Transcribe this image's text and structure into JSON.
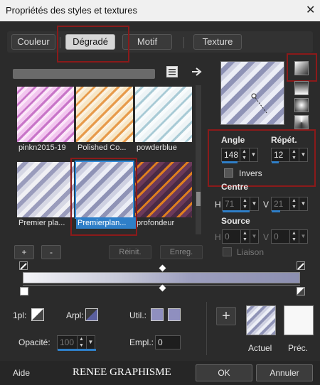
{
  "window": {
    "title": "Propriétés des styles et textures",
    "close_glyph": "✕"
  },
  "tabs": [
    {
      "label": "Couleur"
    },
    {
      "label": "Dégradé"
    },
    {
      "label": "Motif"
    },
    {
      "label": "Texture"
    }
  ],
  "swatches": [
    {
      "label": "pinkn2015-19",
      "colors": [
        "#f2c6ef",
        "#c874c8"
      ]
    },
    {
      "label": "Polished Co...",
      "colors": [
        "#f6e6c6",
        "#e79a4a"
      ]
    },
    {
      "label": "powderblue",
      "colors": [
        "#eef4f6",
        "#a9cbd6"
      ]
    },
    {
      "label": "Premier pla...",
      "colors": [
        "#f0f0f4",
        "#9a9cbc"
      ]
    },
    {
      "label": "Premierplan...",
      "colors": [
        "#eceef6",
        "#8f93b6"
      ]
    },
    {
      "label": "profondeur",
      "colors": [
        "#4a2a44",
        "#e0801e"
      ]
    }
  ],
  "list_buttons": {
    "add": "+",
    "remove": "-",
    "reset": "Réinit.",
    "save": "Enreg."
  },
  "gradient": {
    "angle_label": "Angle",
    "angle_value": "148",
    "repeat_label": "Répét.",
    "repeat_value": "12",
    "invert_label": "Invers",
    "center_label": "Centre",
    "center_h_label": "H",
    "center_h_value": "71",
    "center_v_label": "V",
    "center_v_value": "21",
    "source_label": "Source",
    "source_h_label": "H",
    "source_h_value": "0",
    "source_v_label": "V",
    "source_v_value": "0",
    "link_label": "Liaison",
    "spin_up": "▲",
    "spin_down": "▼",
    "dropdown": "▼"
  },
  "editor": {
    "fg_label": "1pl:",
    "bg_label": "Arpl:",
    "user_label": "Util.:",
    "opacity_label": "Opacité:",
    "opacity_value": "100",
    "location_label": "Empl.:",
    "location_value": "0",
    "user_color_1": "#8f8fbf",
    "user_color_2": "#8f8fbf"
  },
  "compare": {
    "add": "+",
    "current_label": "Actuel",
    "previous_label": "Préc."
  },
  "footer": {
    "help": "Aide",
    "brand": "RENEE GRAPHISME",
    "ok": "OK",
    "cancel": "Annuler"
  },
  "colors": {
    "accent": "#2f7fc8",
    "highlight": "#8b1a1a",
    "panel": "#2b2b2b"
  }
}
